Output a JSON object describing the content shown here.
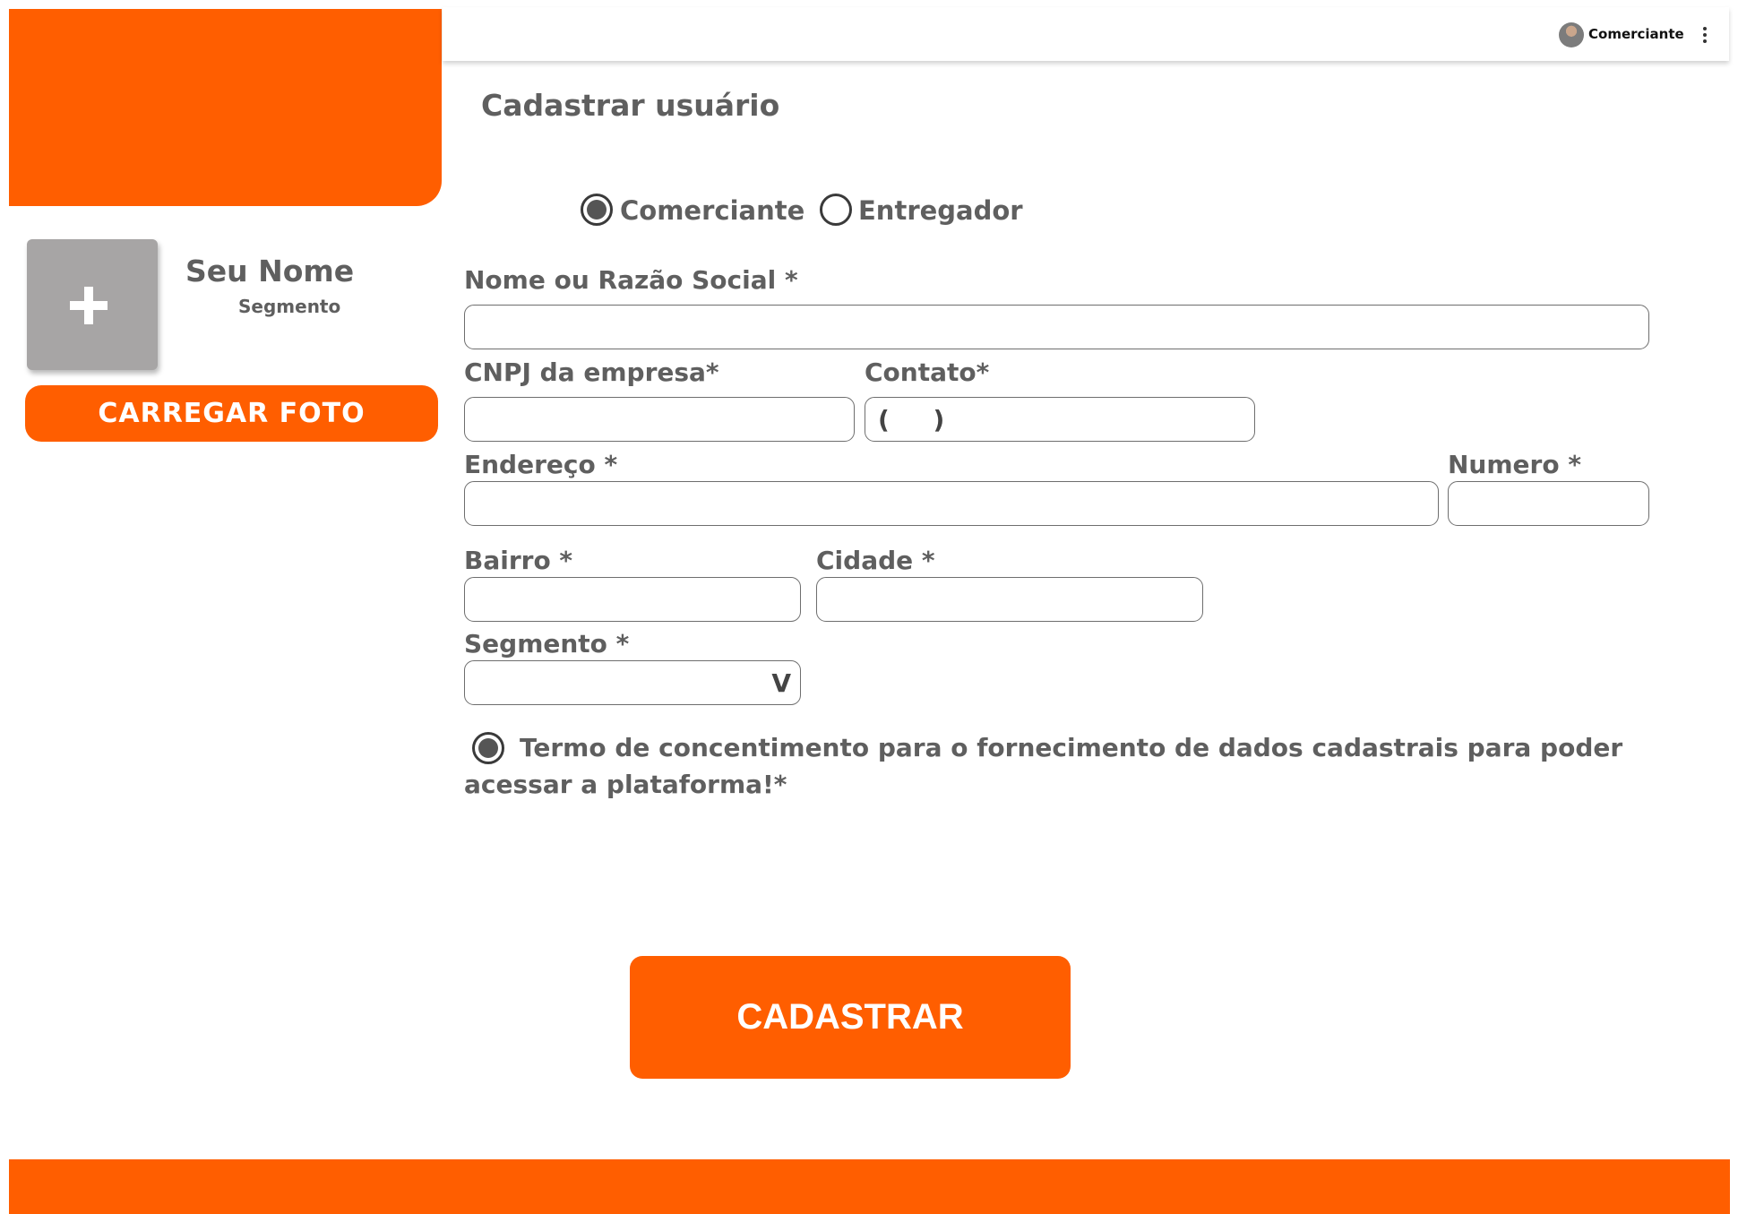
{
  "header": {
    "user_name": "Comerciante",
    "avatar_icon": "user-avatar-icon",
    "menu_icon": "more-vert-icon"
  },
  "page": {
    "title": "Cadastrar usuário"
  },
  "user_type": {
    "options": [
      "Comerciante",
      "Entregador"
    ],
    "selected": "Comerciante"
  },
  "profile": {
    "name": "Seu Nome",
    "segment": "Segmento",
    "upload_label": "CARREGAR FOTO",
    "photo_icon": "plus-icon"
  },
  "form": {
    "name_label": "Nome ou Razão Social *",
    "name_value": "",
    "cnpj_label": "CNPJ da empresa*",
    "cnpj_value": "",
    "contact_label": "Contato*",
    "contact_value": "(     )",
    "address_label": "Endereço *",
    "address_value": "",
    "number_label": "Numero *",
    "number_value": "",
    "district_label": "Bairro *",
    "district_value": "",
    "city_label": "Cidade *",
    "city_value": "",
    "segment_label": "Segmento *",
    "segment_value": "",
    "segment_arrow": "V",
    "consent_checked": true,
    "consent_text": "Termo de concentimento para o fornecimento de dados cadastrais para poder acessar a plataforma!*"
  },
  "actions": {
    "submit_label": "CADASTRAR"
  },
  "colors": {
    "accent": "#ff5e00",
    "text": "#5f5f5f",
    "photo_placeholder": "#a7a5a5"
  }
}
